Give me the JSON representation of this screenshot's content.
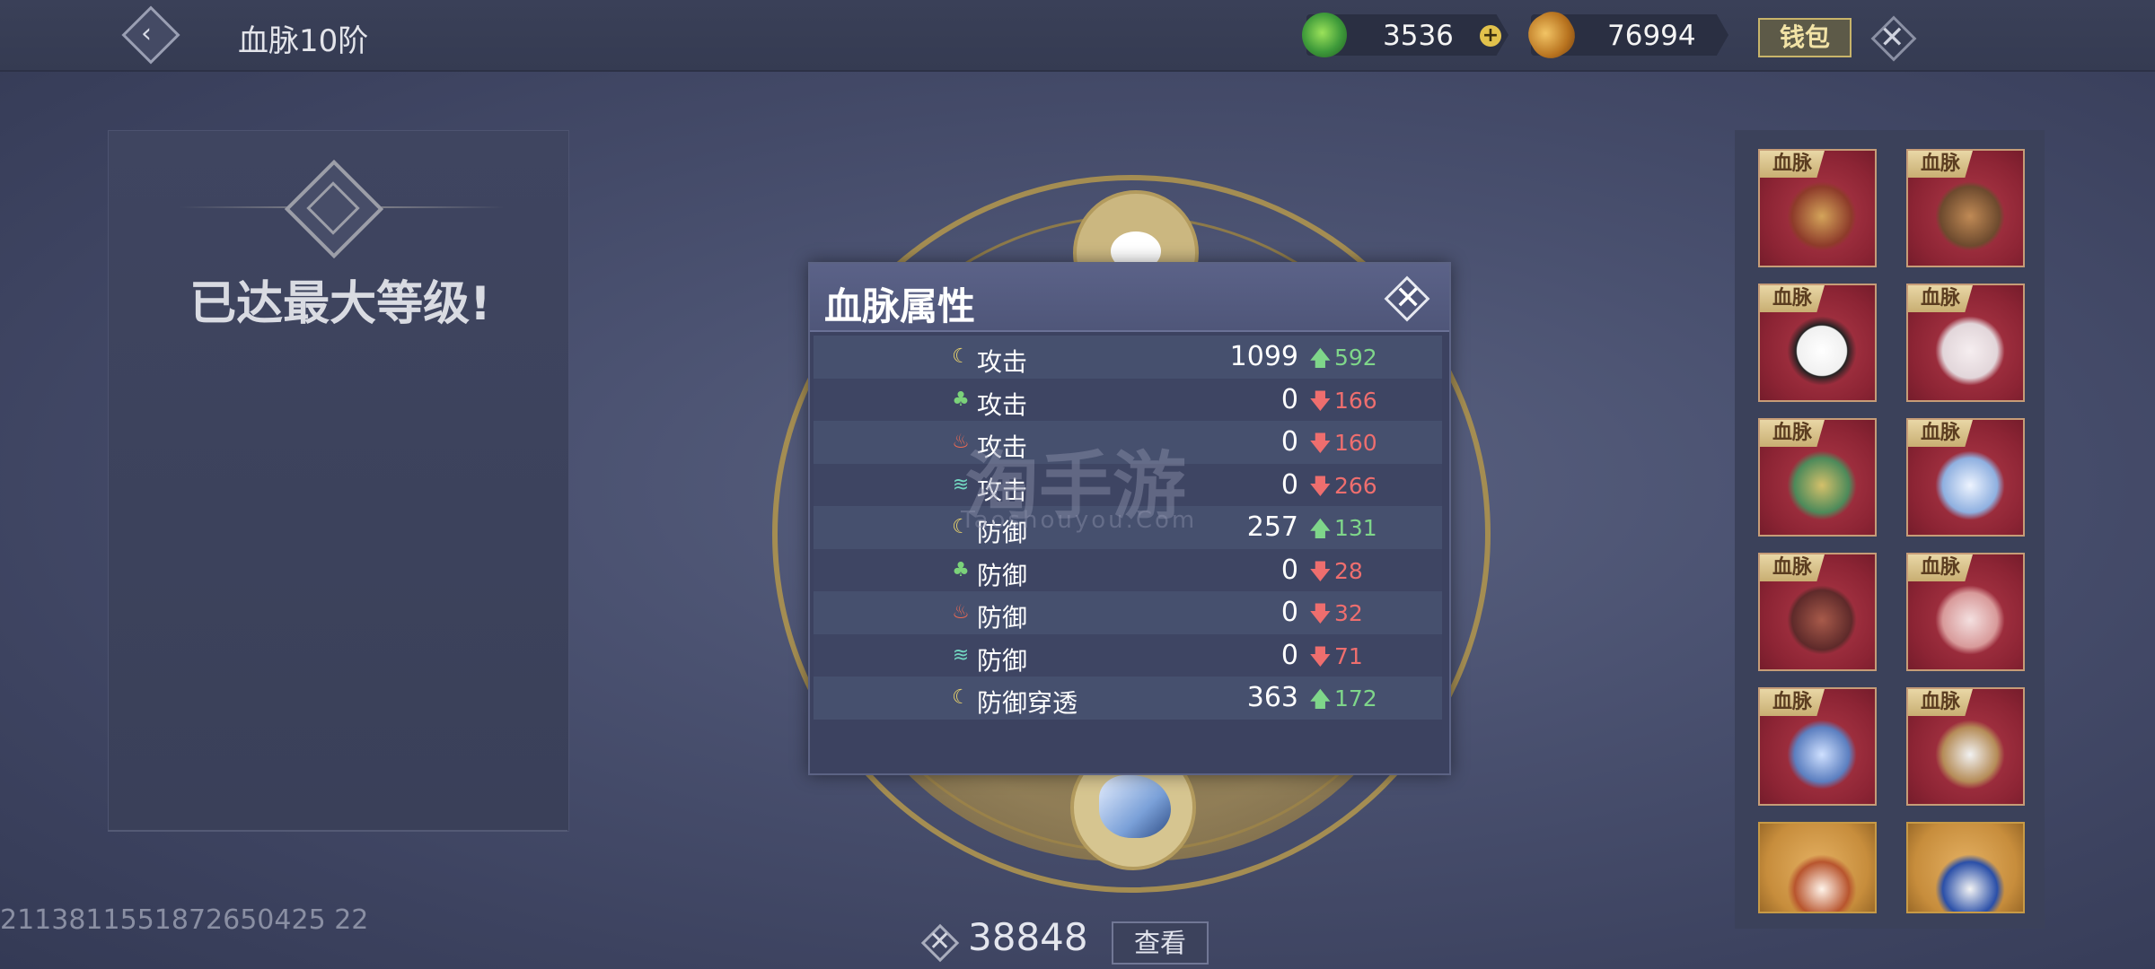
{
  "header": {
    "title": "血脉10阶",
    "currencies": [
      {
        "icon": "jade-coin-icon",
        "value": "3536"
      },
      {
        "icon": "gold-ingot-icon",
        "value": "76994"
      }
    ],
    "wallet_label": "钱包"
  },
  "left_panel": {
    "message": "已达最大等级!"
  },
  "account_id": "2113811551872650425 22",
  "watermark": {
    "text": "淘手游",
    "sub": "Taoshouyou.Com"
  },
  "dialog": {
    "title": "血脉属性",
    "stats": [
      {
        "element": "moon",
        "name": "攻击",
        "value": "1099",
        "direction": "up",
        "delta": "592"
      },
      {
        "element": "palm",
        "name": "攻击",
        "value": "0",
        "direction": "down",
        "delta": "166"
      },
      {
        "element": "fire",
        "name": "攻击",
        "value": "0",
        "direction": "down",
        "delta": "160"
      },
      {
        "element": "wind",
        "name": "攻击",
        "value": "0",
        "direction": "down",
        "delta": "266"
      },
      {
        "element": "moon",
        "name": "防御",
        "value": "257",
        "direction": "up",
        "delta": "131"
      },
      {
        "element": "palm",
        "name": "防御",
        "value": "0",
        "direction": "down",
        "delta": "28"
      },
      {
        "element": "fire",
        "name": "防御",
        "value": "0",
        "direction": "down",
        "delta": "32"
      },
      {
        "element": "wind",
        "name": "防御",
        "value": "0",
        "direction": "down",
        "delta": "71"
      },
      {
        "element": "moon",
        "name": "防御穿透",
        "value": "363",
        "direction": "up",
        "delta": "172"
      }
    ]
  },
  "bloodline_cards": [
    {
      "tag": "血脉",
      "beast": "red-dragon"
    },
    {
      "tag": "血脉",
      "beast": "brown-dragon"
    },
    {
      "tag": "血脉",
      "beast": "panda"
    },
    {
      "tag": "血脉",
      "beast": "white-cat"
    },
    {
      "tag": "血脉",
      "beast": "green-dragon"
    },
    {
      "tag": "血脉",
      "beast": "blue-eagle"
    },
    {
      "tag": "血脉",
      "beast": "demon-boar"
    },
    {
      "tag": "血脉",
      "beast": "lion-dance"
    },
    {
      "tag": "血脉",
      "beast": "blue-dragon"
    },
    {
      "tag": "血脉",
      "beast": "brown-eagle"
    },
    {
      "tag": "",
      "beast": "weasel"
    },
    {
      "tag": "",
      "beast": "peacock"
    }
  ],
  "footer": {
    "power_value": "38848",
    "view_label": "查看"
  },
  "colors": {
    "up": "#7fd68a",
    "down": "#ee6e6e",
    "accent_gold": "#c8b46a"
  }
}
